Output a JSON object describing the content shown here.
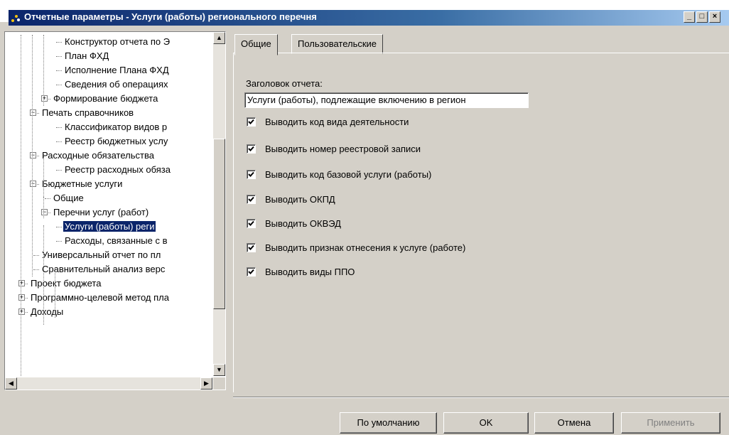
{
  "window": {
    "title": "Отчетные параметры - Услуги (работы) регионального перечня"
  },
  "tree": {
    "items": [
      {
        "label": "Конструктор отчета по Э",
        "depth": 4
      },
      {
        "label": "План ФХД",
        "depth": 4
      },
      {
        "label": "Исполнение Плана ФХД",
        "depth": 4
      },
      {
        "label": "Сведения об операциях",
        "depth": 4
      },
      {
        "label": "Формирование бюджета",
        "depth": 3,
        "expander": "+"
      },
      {
        "label": "Печать справочников",
        "depth": 2,
        "expander": "-"
      },
      {
        "label": "Классификатор видов р",
        "depth": 4
      },
      {
        "label": "Реестр бюджетных услу",
        "depth": 4
      },
      {
        "label": "Расходные обязательства",
        "depth": 2,
        "expander": "-"
      },
      {
        "label": "Реестр расходных обяза",
        "depth": 4
      },
      {
        "label": "Бюджетные услуги",
        "depth": 2,
        "expander": "-"
      },
      {
        "label": "Общие",
        "depth": 3
      },
      {
        "label": "Перечни услуг (работ)",
        "depth": 3,
        "expander": "-"
      },
      {
        "label": "Услуги (работы) реги",
        "depth": 4,
        "selected": true
      },
      {
        "label": "Расходы, связанные с в",
        "depth": 4
      },
      {
        "label": "Универсальный отчет по пл",
        "depth": 2
      },
      {
        "label": "Сравнительный анализ верс",
        "depth": 2
      },
      {
        "label": "Проект бюджета",
        "depth": 1,
        "expander": "+"
      },
      {
        "label": "Программно-целевой метод пла",
        "depth": 1,
        "expander": "+"
      },
      {
        "label": "Доходы",
        "depth": 1,
        "expander": "+"
      }
    ]
  },
  "tabs": [
    {
      "label": "Общие",
      "active": true
    },
    {
      "label": "Пользовательские",
      "active": false
    }
  ],
  "form": {
    "report_title_label": "Заголовок отчета:",
    "report_title_value": "Услуги (работы), подлежащие включению в регион",
    "checkboxes": [
      {
        "label": "Выводить код вида деятельности",
        "checked": true
      },
      {
        "label": "Выводить номер реестровой записи",
        "checked": true
      },
      {
        "label": "Выводить код базовой услуги (работы)",
        "checked": true
      },
      {
        "label": "Выводить ОКПД",
        "checked": true
      },
      {
        "label": "Выводить ОКВЭД",
        "checked": true
      },
      {
        "label": "Выводить признак отнесения к услуге (работе)",
        "checked": true
      },
      {
        "label": "Выводить виды ППО",
        "checked": true
      }
    ]
  },
  "buttons": {
    "default": "По умолчанию",
    "ok": "OK",
    "cancel": "Отмена",
    "apply": "Применить"
  },
  "colors": {
    "title_start": "#0a246a",
    "title_end": "#a6caf0",
    "selection": "#0a246a",
    "face": "#d4d0c8"
  }
}
